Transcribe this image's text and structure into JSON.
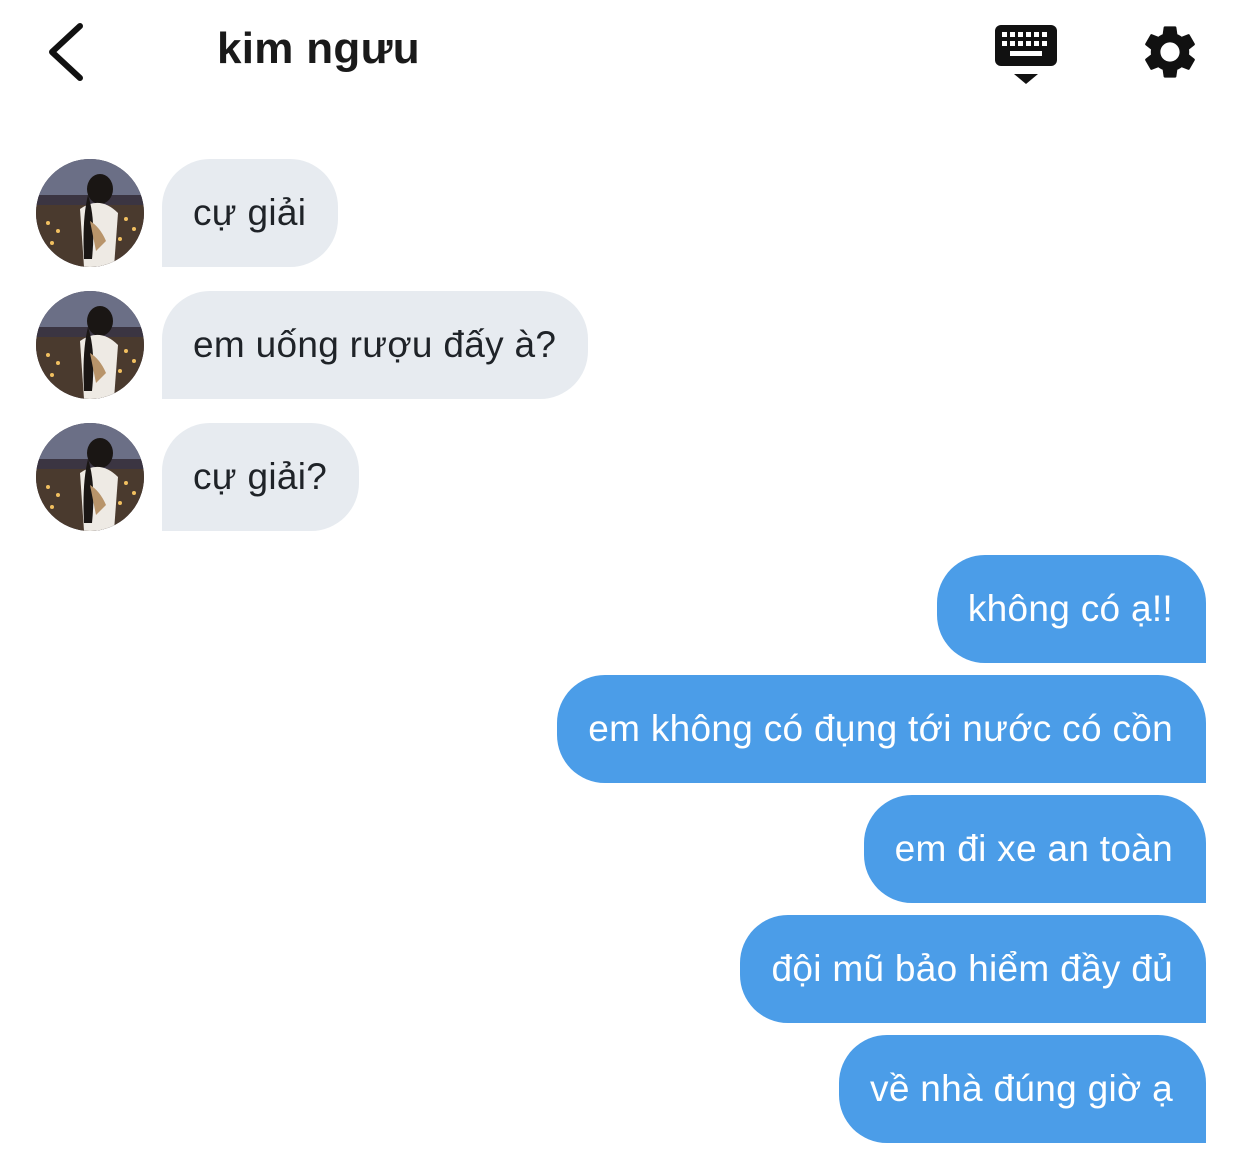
{
  "header": {
    "title": "kim ngưu",
    "back_icon": "chevron-left-icon",
    "keyboard_icon": "keyboard-hide-icon",
    "settings_icon": "gear-icon"
  },
  "messages": [
    {
      "from": "contact",
      "text": "cự giải"
    },
    {
      "from": "contact",
      "text": "em uống rượu đấy à?"
    },
    {
      "from": "contact",
      "text": "cự giải?"
    },
    {
      "from": "me",
      "text": "không có ạ!!"
    },
    {
      "from": "me",
      "text": "em không có đụng tới nước có cồn"
    },
    {
      "from": "me",
      "text": "em đi xe an toàn"
    },
    {
      "from": "me",
      "text": "đội mũ bảo hiểm đầy đủ"
    },
    {
      "from": "me",
      "text": "về nhà đúng giờ ạ"
    }
  ],
  "colors": {
    "incoming_bubble": "#e7ebf0",
    "outgoing_bubble": "#4b9de8",
    "outgoing_text": "#ffffff",
    "icon": "#111111"
  }
}
